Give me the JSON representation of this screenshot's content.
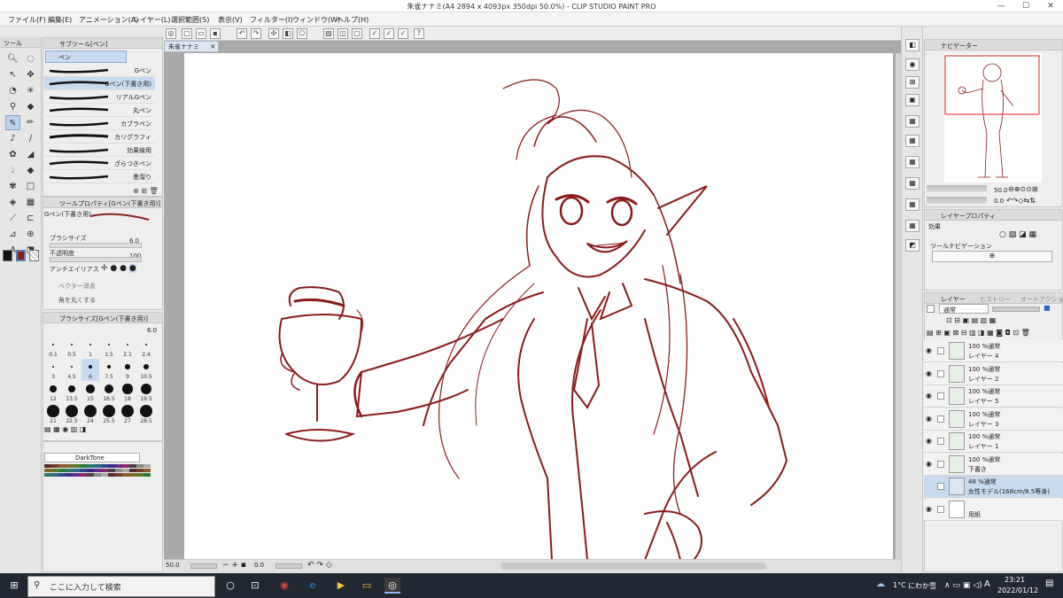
{
  "window": {
    "title": "朱雀ナナミ(A4 2894 x 4093px 350dpi 50.0%) - CLIP STUDIO PAINT PRO",
    "minimize": "—",
    "maximize": "☐",
    "close": "✕"
  },
  "menu": [
    "ファイル(F)",
    "編集(E)",
    "アニメーション(A)",
    "レイヤー(L)",
    "選択範囲(S)",
    "表示(V)",
    "フィルター(I)",
    "ウィンドウ(W)",
    "ヘルプ(H)"
  ],
  "tool_panel": {
    "label": "ツール"
  },
  "subtool": {
    "tab": "サブツール[ペン]",
    "group": "ペン",
    "brushes": [
      "Gペン",
      "Gペン(下書き用)",
      "リアルGペン",
      "丸ペン",
      "カブラペン",
      "カリグラフィ",
      "効果線用",
      "ざらつきペン",
      "墨溜り"
    ],
    "selected_index": 1
  },
  "tool_property": {
    "tab": "ツールプロパティ[Gペン(下書き用)]",
    "preset": "Gペン(下書き用)",
    "brush_size_label": "ブラシサイズ",
    "brush_size": "6.0",
    "opacity_label": "不透明度",
    "opacity": "100",
    "aa_label": "アンチエイリアス",
    "vector_erase_label": "ベクター消去",
    "stabilize_label": "角を丸くする"
  },
  "brush_size_panel": {
    "tab": "ブラシサイズ[Gペン(下書き用)]",
    "current": "6.0",
    "sizes": [
      "0.1",
      "0.5",
      "1",
      "1.5",
      "2.1",
      "2.4",
      "3",
      "4.5",
      "6",
      "7.5",
      "9",
      "10.5",
      "12",
      "13.5",
      "15",
      "16.5",
      "18",
      "19.5",
      "21",
      "22.5",
      "24",
      "25.5",
      "27",
      "28.5"
    ],
    "selected": "6"
  },
  "color_set": {
    "name": "DarkTone"
  },
  "document": {
    "tab": "朱雀ナナミ",
    "tab_close": "✕"
  },
  "canvas_status": {
    "zoom": "50.0",
    "angle": "0.0",
    "brush_value": "6.0"
  },
  "navigator": {
    "tab": "ナビゲーター",
    "zoom": "50.0",
    "rotation": "0.0"
  },
  "layer_property": {
    "tab": "レイヤープロパティ",
    "effect_label": "効果",
    "tool_nav_label": "ツールナビゲーション"
  },
  "layers": {
    "tab": "レイヤー",
    "tab2": "ヒストリー",
    "tab3": "オートアクション",
    "blend_mode": "通常",
    "rows": [
      {
        "opacity": "100 %通常",
        "name": "レイヤー 4"
      },
      {
        "opacity": "100 %通常",
        "name": "レイヤー 2"
      },
      {
        "opacity": "100 %通常",
        "name": "レイヤー 5"
      },
      {
        "opacity": "100 %通常",
        "name": "レイヤー 3"
      },
      {
        "opacity": "100 %通常",
        "name": "レイヤー 1"
      },
      {
        "opacity": "100 %通常",
        "name": "下書き"
      },
      {
        "opacity": "48 %通常",
        "name": "女性モデル(168cm/8.5等身)"
      },
      {
        "opacity": "",
        "name": "用紙"
      }
    ]
  },
  "taskbar": {
    "search_placeholder": "ここに入力して検索",
    "weather_temp": "1°C",
    "weather_text": "にわか雪",
    "ime": "A",
    "time": "23:21",
    "date": "2022/01/12"
  },
  "colors": {
    "line": "#8b1a1a",
    "main_color": "#8b2020",
    "selection": "#c8daf0"
  }
}
